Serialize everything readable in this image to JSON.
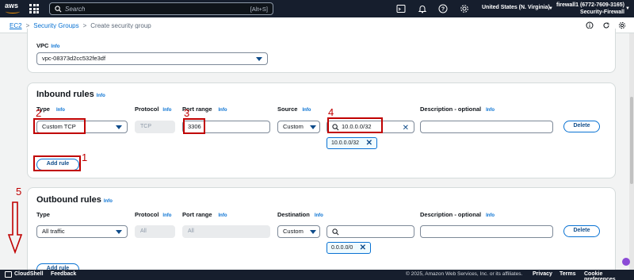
{
  "topbar": {
    "logo": "aws",
    "search_placeholder": "Search",
    "search_shortcut": "[Alt+S]",
    "region": "United States (N. Virginia)",
    "account_name": "firewall1 (6772-7609-3165)",
    "account_role": "Security-Firewall",
    "icons": [
      "cloudshell-icon",
      "bell-icon",
      "help-icon",
      "settings-icon"
    ]
  },
  "breadcrumb": {
    "items": [
      "EC2",
      "Security Groups",
      "Create security group"
    ],
    "separator": ">"
  },
  "vpc_section": {
    "label": "VPC",
    "info": "Info",
    "value": "vpc-08373d2cc532fe3df"
  },
  "inbound": {
    "title": "Inbound rules",
    "info": "Info",
    "columns": {
      "type": "Type",
      "protocol": "Protocol",
      "port_range": "Port range",
      "source": "Source",
      "description": "Description - optional"
    },
    "col_info": "Info",
    "row": {
      "type": "Custom TCP",
      "protocol": "TCP",
      "port_range": "3306",
      "source": "Custom",
      "cidr": "10.0.0.0/32",
      "token": "10.0.0.0/32",
      "description": "",
      "delete": "Delete"
    },
    "add_rule": "Add rule"
  },
  "outbound": {
    "title": "Outbound rules",
    "info": "Info",
    "columns": {
      "type": "Type",
      "protocol": "Protocol",
      "port_range": "Port range",
      "destination": "Destination",
      "description": "Description - optional"
    },
    "col_info": "Info",
    "row": {
      "type": "All traffic",
      "protocol": "All",
      "port_range": "All",
      "destination": "Custom",
      "cidr": "",
      "token": "0.0.0.0/0",
      "description": "",
      "delete": "Delete"
    },
    "add_rule": "Add rule"
  },
  "annotations": [
    "1",
    "2",
    "3",
    "4",
    "5"
  ],
  "footer": {
    "cloudshell": "CloudShell",
    "feedback": "Feedback",
    "copyright": "© 2025, Amazon Web Services, Inc. or its affiliates.",
    "privacy": "Privacy",
    "terms": "Terms",
    "cookies": "Cookie preferences"
  },
  "colors": {
    "nav_bg": "#161e2d",
    "link": "#0972d3",
    "annotation_red": "#c00000",
    "page_bg": "#f2f3f3"
  }
}
